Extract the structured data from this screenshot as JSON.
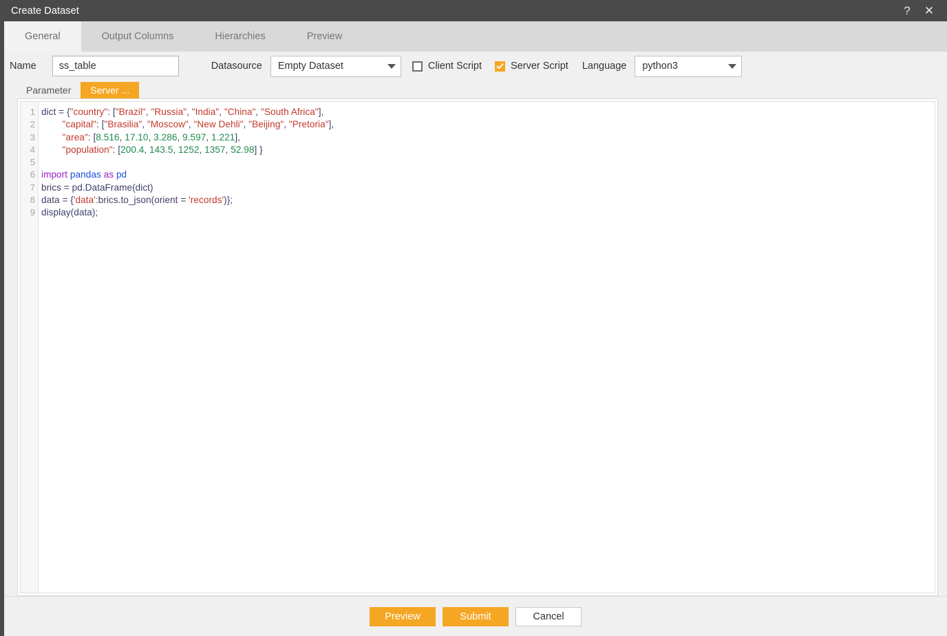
{
  "window": {
    "title": "Create Dataset",
    "help_icon": "question-mark-icon",
    "close_icon": "close-icon",
    "help_glyph": "?",
    "close_glyph": "✕"
  },
  "tabs": [
    {
      "label": "General",
      "active": true
    },
    {
      "label": "Output Columns",
      "active": false
    },
    {
      "label": "Hierarchies",
      "active": false
    },
    {
      "label": "Preview",
      "active": false
    }
  ],
  "form": {
    "name_label": "Name",
    "name_value": "ss_table",
    "name_placeholder": "",
    "datasource_label": "Datasource",
    "datasource_value": "Empty Dataset",
    "datasource_options": [
      "Empty Dataset"
    ],
    "client_script_label": "Client Script",
    "client_script_checked": false,
    "server_script_label": "Server Script",
    "server_script_checked": true,
    "language_label": "Language",
    "language_value": "python3",
    "language_options": [
      "python3"
    ]
  },
  "subtabs": [
    {
      "label": "Parameter",
      "active": false
    },
    {
      "label": "Server ...",
      "active": true
    }
  ],
  "editor": {
    "line_numbers": [
      "1",
      "2",
      "3",
      "4",
      "5",
      "6",
      "7",
      "8",
      "9"
    ],
    "lines": [
      "dict = {\"country\": [\"Brazil\", \"Russia\", \"India\", \"China\", \"South Africa\"],",
      "        \"capital\": [\"Brasilia\", \"Moscow\", \"New Dehli\", \"Beijing\", \"Pretoria\"],",
      "        \"area\": [8.516, 17.10, 3.286, 9.597, 1.221],",
      "        \"population\": [200.4, 143.5, 1252, 1357, 52.98] }",
      "",
      "import pandas as pd",
      "brics = pd.DataFrame(dict)",
      "data = {'data':brics.to_json(orient = 'records')};",
      "display(data);"
    ],
    "tokens": [
      [
        [
          "dict = {",
          "pln"
        ],
        [
          "\"country\"",
          "str"
        ],
        [
          ": [",
          "pln"
        ],
        [
          "\"Brazil\"",
          "str"
        ],
        [
          ", ",
          "pln"
        ],
        [
          "\"Russia\"",
          "str"
        ],
        [
          ", ",
          "pln"
        ],
        [
          "\"India\"",
          "str"
        ],
        [
          ", ",
          "pln"
        ],
        [
          "\"China\"",
          "str"
        ],
        [
          ", ",
          "pln"
        ],
        [
          "\"South Africa\"",
          "str"
        ],
        [
          "],",
          "pln"
        ]
      ],
      [
        [
          "        ",
          "pln"
        ],
        [
          "\"capital\"",
          "str"
        ],
        [
          ": [",
          "pln"
        ],
        [
          "\"Brasilia\"",
          "str"
        ],
        [
          ", ",
          "pln"
        ],
        [
          "\"Moscow\"",
          "str"
        ],
        [
          ", ",
          "pln"
        ],
        [
          "\"New Dehli\"",
          "str"
        ],
        [
          ", ",
          "pln"
        ],
        [
          "\"Beijing\"",
          "str"
        ],
        [
          ", ",
          "pln"
        ],
        [
          "\"Pretoria\"",
          "str"
        ],
        [
          "],",
          "pln"
        ]
      ],
      [
        [
          "        ",
          "pln"
        ],
        [
          "\"area\"",
          "str"
        ],
        [
          ": [",
          "pln"
        ],
        [
          "8.516",
          "num"
        ],
        [
          ", ",
          "pln"
        ],
        [
          "17.10",
          "num"
        ],
        [
          ", ",
          "pln"
        ],
        [
          "3.286",
          "num"
        ],
        [
          ", ",
          "pln"
        ],
        [
          "9.597",
          "num"
        ],
        [
          ", ",
          "pln"
        ],
        [
          "1.221",
          "num"
        ],
        [
          "],",
          "pln"
        ]
      ],
      [
        [
          "        ",
          "pln"
        ],
        [
          "\"population\"",
          "str"
        ],
        [
          ": [",
          "pln"
        ],
        [
          "200.4",
          "num"
        ],
        [
          ", ",
          "pln"
        ],
        [
          "143.5",
          "num"
        ],
        [
          ", ",
          "pln"
        ],
        [
          "1252",
          "num"
        ],
        [
          ", ",
          "pln"
        ],
        [
          "1357",
          "num"
        ],
        [
          ", ",
          "pln"
        ],
        [
          "52.98",
          "num"
        ],
        [
          "] }",
          "pln"
        ]
      ],
      [],
      [
        [
          "import ",
          "kw"
        ],
        [
          "pandas ",
          "mod"
        ],
        [
          "as ",
          "kw"
        ],
        [
          "pd",
          "mod"
        ]
      ],
      [
        [
          "brics = pd.DataFrame(dict)",
          "pln"
        ]
      ],
      [
        [
          "data = {",
          "pln"
        ],
        [
          "'data'",
          "str"
        ],
        [
          ":brics.to_json(orient = ",
          "pln"
        ],
        [
          "'records'",
          "str"
        ],
        [
          ")};",
          "pln"
        ]
      ],
      [
        [
          "display(data);",
          "pln"
        ]
      ]
    ]
  },
  "footer": {
    "preview_label": "Preview",
    "submit_label": "Submit",
    "cancel_label": "Cancel"
  },
  "colors": {
    "accent": "#f5a623",
    "titlebar": "#4a4a4a",
    "tabbar": "#d9d9d9",
    "panel": "#f0f0f0",
    "string": "#c0392b",
    "number": "#1f8a4c",
    "keyword": "#9b1fcc",
    "module": "#1a4fd6",
    "plain": "#3f3f6b"
  }
}
